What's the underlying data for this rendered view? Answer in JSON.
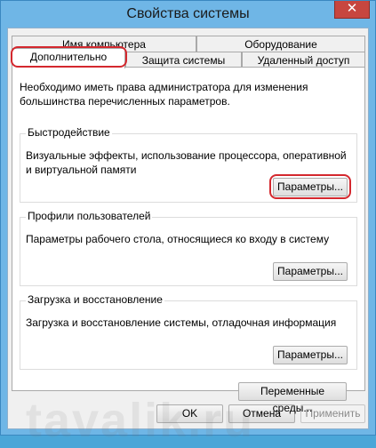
{
  "window": {
    "title": "Свойства системы",
    "close_glyph": "✕"
  },
  "tabs": {
    "row1": [
      {
        "label": "Имя компьютера"
      },
      {
        "label": "Оборудование"
      }
    ],
    "row2": [
      {
        "label": "Дополнительно",
        "active": true
      },
      {
        "label": "Защита системы"
      },
      {
        "label": "Удаленный доступ"
      }
    ]
  },
  "panel": {
    "notice": "Необходимо иметь права администратора для изменения большинства перечисленных параметров.",
    "performance": {
      "title": "Быстродействие",
      "description": "Визуальные эффекты, использование процессора, оперативной и виртуальной памяти",
      "button": "Параметры..."
    },
    "profiles": {
      "title": "Профили пользователей",
      "description": "Параметры рабочего стола, относящиеся ко входу в систему",
      "button": "Параметры..."
    },
    "startup": {
      "title": "Загрузка и восстановление",
      "description": "Загрузка и восстановление системы, отладочная информация",
      "button": "Параметры..."
    },
    "env_button": "Переменные среды..."
  },
  "footer": {
    "ok": "OK",
    "cancel": "Отмена",
    "apply": "Применить"
  },
  "watermark": "tavalik.ru",
  "colors": {
    "highlight": "#d4282e",
    "close": "#c7463f",
    "frame": "#6fb6e6"
  }
}
